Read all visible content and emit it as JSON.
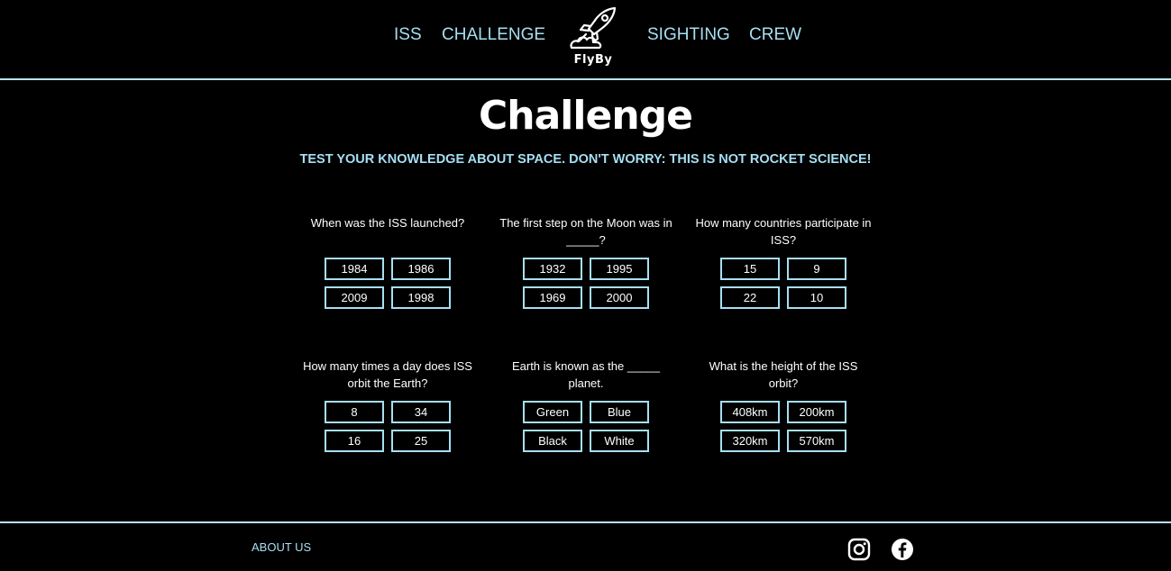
{
  "nav": {
    "left": [
      "ISS",
      "CHALLENGE"
    ],
    "right": [
      "SIGHTING",
      "CREW"
    ],
    "logo_text": "FlyBy"
  },
  "title": "Challenge",
  "subtitle": "TEST YOUR KNOWLEDGE ABOUT SPACE. DON'T WORRY: THIS IS NOT ROCKET SCIENCE!",
  "questions": [
    {
      "text": "When was the ISS launched?",
      "options": [
        "1984",
        "1986",
        "2009",
        "1998"
      ]
    },
    {
      "text": "The first step on the Moon was in _____?",
      "options": [
        "1932",
        "1995",
        "1969",
        "2000"
      ]
    },
    {
      "text": "How many countries participate in ISS?",
      "options": [
        "15",
        "9",
        "22",
        "10"
      ]
    },
    {
      "text": "How many times a day does ISS orbit the Earth?",
      "options": [
        "8",
        "34",
        "16",
        "25"
      ]
    },
    {
      "text": "Earth is known as the _____ planet.",
      "options": [
        "Green",
        "Blue",
        "Black",
        "White"
      ]
    },
    {
      "text": "What is the height of the ISS orbit?",
      "options": [
        "408km",
        "200km",
        "320km",
        "570km"
      ]
    }
  ],
  "footer": {
    "about": "ABOUT US",
    "social_icons": [
      "instagram-icon",
      "facebook-icon"
    ]
  },
  "colors": {
    "background": "#000000",
    "accent": "#a7dff3",
    "text": "#ffffff"
  }
}
